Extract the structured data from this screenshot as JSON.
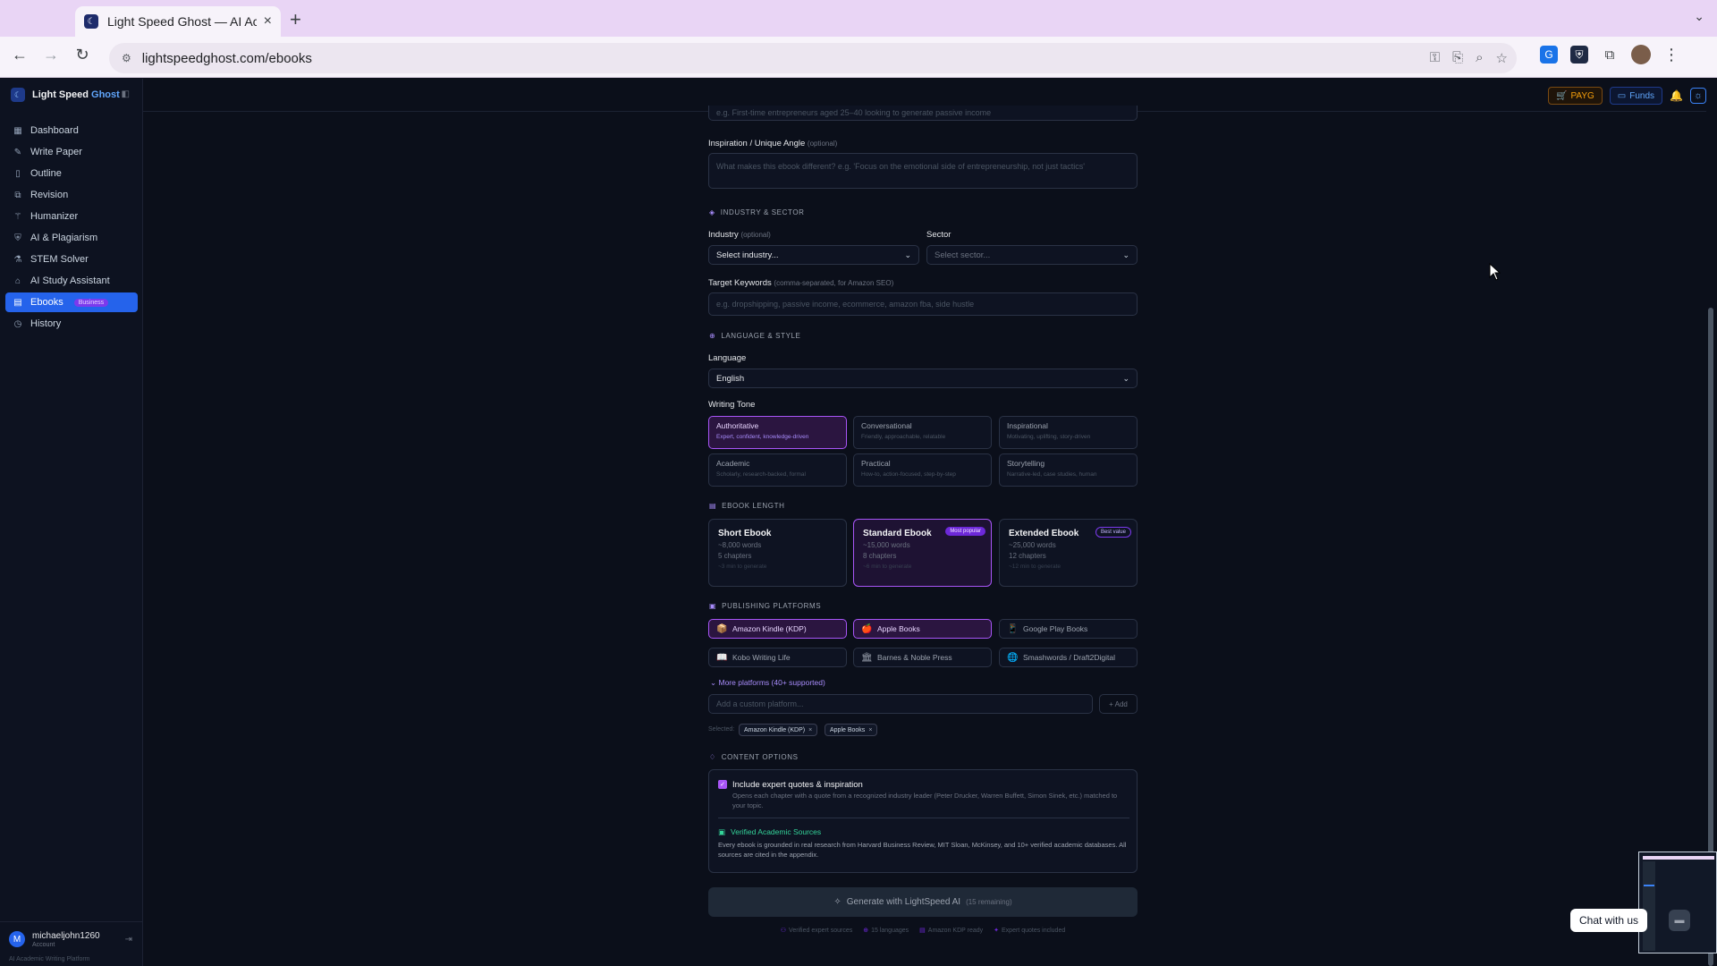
{
  "browser": {
    "tab_title": "Light Speed Ghost — AI Acad",
    "url": "lightspeedghost.com/ebooks"
  },
  "app": {
    "brand_prefix": "Light Speed",
    "brand_accent": "Ghost",
    "header": {
      "payg": "PAYG",
      "funds": "Funds"
    }
  },
  "sidebar": {
    "items": [
      {
        "label": "Dashboard",
        "icon": "grid-icon"
      },
      {
        "label": "Write Paper",
        "icon": "pen-icon"
      },
      {
        "label": "Outline",
        "icon": "book-icon"
      },
      {
        "label": "Revision",
        "icon": "copy-icon"
      },
      {
        "label": "Humanizer",
        "icon": "wand-icon"
      },
      {
        "label": "AI & Plagiarism",
        "icon": "shield-icon"
      },
      {
        "label": "STEM Solver",
        "icon": "flask-icon"
      },
      {
        "label": "AI Study Assistant",
        "icon": "grad-cap-icon"
      },
      {
        "label": "Ebooks",
        "icon": "ebook-icon",
        "badge": "Business"
      },
      {
        "label": "History",
        "icon": "clock-icon"
      }
    ],
    "user": {
      "initial": "M",
      "name": "michaeljohn1260",
      "role": "Account",
      "tagline": "AI Academic Writing Platform"
    }
  },
  "form": {
    "audience_placeholder": "e.g. First-time entrepreneurs aged 25–40 looking to generate passive income",
    "inspiration_label": "Inspiration / Unique Angle",
    "optional": "(optional)",
    "inspiration_placeholder": "What makes this ebook different? e.g. 'Focus on the emotional side of entrepreneurship, not just tactics'",
    "section_industry": "INDUSTRY & SECTOR",
    "industry_label": "Industry",
    "industry_value": "Select industry...",
    "sector_label": "Sector",
    "sector_value": "Select sector...",
    "keywords_label": "Target Keywords",
    "keywords_hint": "(comma-separated, for Amazon SEO)",
    "keywords_placeholder": "e.g. dropshipping, passive income, ecommerce, amazon fba, side hustle",
    "section_language": "LANGUAGE & STYLE",
    "language_label": "Language",
    "language_value": "English",
    "tone_label": "Writing Tone",
    "tones": [
      {
        "title": "Authoritative",
        "desc": "Expert, confident, knowledge-driven",
        "selected": true
      },
      {
        "title": "Conversational",
        "desc": "Friendly, approachable, relatable",
        "selected": false
      },
      {
        "title": "Inspirational",
        "desc": "Motivating, uplifting, story-driven",
        "selected": false
      },
      {
        "title": "Academic",
        "desc": "Scholarly, research-backed, formal",
        "selected": false
      },
      {
        "title": "Practical",
        "desc": "How-to, action-focused, step-by-step",
        "selected": false
      },
      {
        "title": "Storytelling",
        "desc": "Narrative-led, case studies, human",
        "selected": false
      }
    ],
    "section_length": "EBOOK LENGTH",
    "lengths": [
      {
        "title": "Short Ebook",
        "words": "~8,000 words",
        "chapters": "5 chapters",
        "time": "~3 min to generate",
        "badge": "",
        "selected": false
      },
      {
        "title": "Standard Ebook",
        "words": "~15,000 words",
        "chapters": "8 chapters",
        "time": "~6 min to generate",
        "badge": "Most popular",
        "selected": true
      },
      {
        "title": "Extended Ebook",
        "words": "~25,000 words",
        "chapters": "12 chapters",
        "time": "~12 min to generate",
        "badge": "Best value",
        "selected": false
      }
    ],
    "section_platforms": "PUBLISHING PLATFORMS",
    "platforms": [
      {
        "label": "Amazon Kindle (KDP)",
        "icon": "📦",
        "selected": true
      },
      {
        "label": "Apple Books",
        "icon": "🍎",
        "selected": true
      },
      {
        "label": "Google Play Books",
        "icon": "📱",
        "selected": false
      },
      {
        "label": "Kobo Writing Life",
        "icon": "📖",
        "selected": false
      },
      {
        "label": "Barnes & Noble Press",
        "icon": "🏛",
        "selected": false
      },
      {
        "label": "Smashwords / Draft2Digital",
        "icon": "🌐",
        "selected": false
      }
    ],
    "more_platforms": "More platforms (40+ supported)",
    "custom_placeholder": "Add a custom platform...",
    "add_label": "+ Add",
    "selected_label": "Selected:",
    "selected_chips": [
      "Amazon Kindle (KDP)",
      "Apple Books"
    ],
    "section_content": "CONTENT OPTIONS",
    "quotes_title": "Include expert quotes & inspiration",
    "quotes_desc": "Opens each chapter with a quote from a recognized industry leader (Peter Drucker, Warren Buffett, Simon Sinek, etc.) matched to your topic.",
    "verified_title": "Verified Academic Sources",
    "verified_desc": "Every ebook is grounded in real research from Harvard Business Review, MIT Sloan, McKinsey, and 10+ verified academic databases. All sources are cited in the appendix.",
    "generate_label": "Generate with LightSpeed AI",
    "generate_remaining": "(15 remaining)",
    "footnotes": [
      "Verified expert sources",
      "15 languages",
      "Amazon KDP ready",
      "Expert quotes included"
    ]
  },
  "chat": {
    "label": "Chat with us"
  }
}
